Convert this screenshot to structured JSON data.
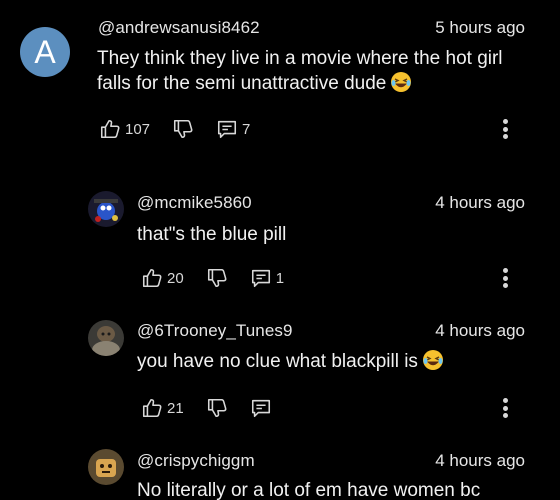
{
  "icons": {
    "like": "thumbs-up-icon",
    "dislike": "thumbs-down-icon",
    "reply": "reply-icon",
    "more": "more-vert-icon",
    "emoji": "laughing-emoji"
  },
  "colors": {
    "background": "#000000",
    "text": "#f1f1f1",
    "avatar_a": "#5c8fbf",
    "emoji": "#f6c12e"
  },
  "comments": [
    {
      "avatar_letter": "A",
      "handle": "@andrewsanusi8462",
      "time": "5 hours ago",
      "text_line1": "They think they live in a movie where the hot girl",
      "text_line2": "falls for the semi unattractive dude",
      "likes": "107",
      "replies": "7"
    },
    {
      "handle": "@mcmike5860",
      "time": "4 hours ago",
      "text_line1": "that\"s the blue pill",
      "likes": "20",
      "replies": "1"
    },
    {
      "handle": "@6Trooney_Tunes9",
      "time": "4 hours ago",
      "text_line1": "you have no clue what blackpill is",
      "likes": "21"
    },
    {
      "handle": "@crispychiggm",
      "time": "4 hours ago",
      "text_line1": "No literally or a lot of em have women bc"
    }
  ]
}
